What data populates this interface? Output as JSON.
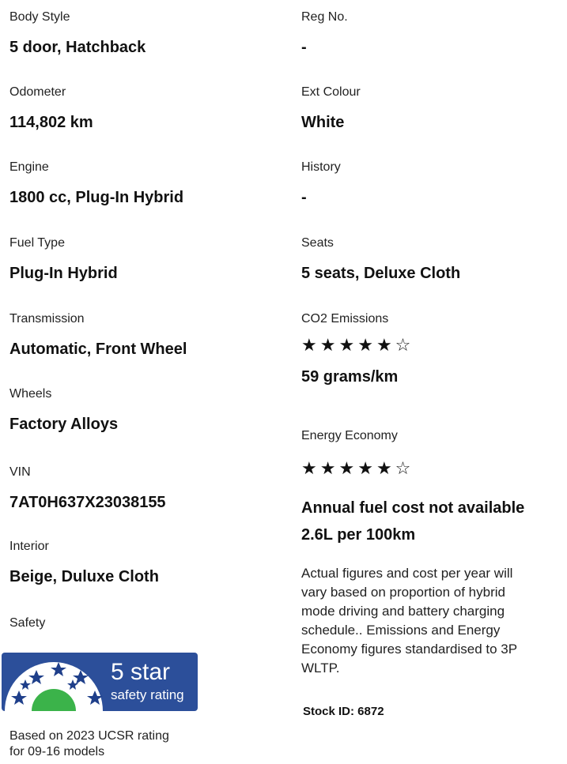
{
  "left": [
    {
      "label": "Body Style",
      "value": "5 door, Hatchback"
    },
    {
      "label": "Odometer",
      "value": "114,802 km"
    },
    {
      "label": "Engine",
      "value": "1800 cc, Plug-In Hybrid"
    },
    {
      "label": "Fuel Type",
      "value": "Plug-In Hybrid"
    },
    {
      "label": "Transmission",
      "value": "Automatic, Front Wheel"
    },
    {
      "label": "Wheels",
      "value": "Factory Alloys"
    },
    {
      "label": "VIN",
      "value": "7AT0H637X23038155"
    },
    {
      "label": "Interior",
      "value": "Beige, Duluxe Cloth"
    }
  ],
  "safety": {
    "label": "Safety",
    "badge_rating": "5 star",
    "badge_caption": "safety rating",
    "stars": 5,
    "note_line1": "Based on 2023 UCSR rating",
    "note_line2": "for 09-16 models"
  },
  "right": [
    {
      "label": "Reg No.",
      "value": "-"
    },
    {
      "label": "Ext Colour",
      "value": "White"
    },
    {
      "label": "History",
      "value": "-"
    },
    {
      "label": "Seats",
      "value": "5 seats, Deluxe Cloth"
    }
  ],
  "co2": {
    "label": "CO2 Emissions",
    "rating": 5,
    "out_of": 6,
    "value": "59 grams/km"
  },
  "energy": {
    "label": "Energy Economy",
    "rating": 5,
    "out_of": 6,
    "value_line1": "Annual fuel cost not available",
    "value_line2": "2.6L per 100km"
  },
  "note": {
    "line1": "Actual figures and cost per year will",
    "line2": "vary based on proportion of hybrid",
    "line3": "mode driving and battery charging",
    "line4": "schedule.. Emissions and Energy",
    "line5": "Economy figures standardised to 3P",
    "line6": "WLTP."
  },
  "stock": "Stock ID: 6872",
  "colors": {
    "badge_bg": "#2c4f9a",
    "badge_star": "#1f3f8a",
    "badge_green": "#3bb34a"
  }
}
